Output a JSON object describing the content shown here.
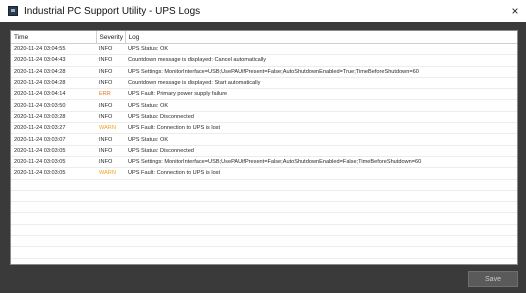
{
  "window": {
    "title": "Industrial PC Support Utility - UPS Logs",
    "close_glyph": "×"
  },
  "table": {
    "columns": [
      "Time",
      "Severity",
      "Log"
    ],
    "rows": [
      {
        "time": "2020-11-24 03:04:55",
        "severity": "INFO",
        "log": "UPS Status: OK"
      },
      {
        "time": "2020-11-24 03:04:43",
        "severity": "INFO",
        "log": "Countdown message is displayed: Cancel automatically"
      },
      {
        "time": "2020-11-24 03:04:28",
        "severity": "INFO",
        "log": "UPS Settings: MonitorInterface=USB;UsePAUifPresent=False;AutoShutdownEnabled=True;TimeBeforeShutdown=60"
      },
      {
        "time": "2020-11-24 03:04:28",
        "severity": "INFO",
        "log": "Countdown message is displayed: Start automatically"
      },
      {
        "time": "2020-11-24 03:04:14",
        "severity": "ERR",
        "log": "UPS Fault: Primary power supply failure"
      },
      {
        "time": "2020-11-24 03:03:50",
        "severity": "INFO",
        "log": "UPS Status: OK"
      },
      {
        "time": "2020-11-24 03:03:28",
        "severity": "INFO",
        "log": "UPS Status: Disconnected"
      },
      {
        "time": "2020-11-24 03:03:27",
        "severity": "WARN",
        "log": "UPS Fault: Connection to UPS is lost"
      },
      {
        "time": "2020-11-24 03:03:07",
        "severity": "INFO",
        "log": "UPS Status: OK"
      },
      {
        "time": "2020-11-24 03:03:05",
        "severity": "INFO",
        "log": "UPS Status: Disconnected"
      },
      {
        "time": "2020-11-24 03:03:05",
        "severity": "INFO",
        "log": "UPS Settings: MonitorInterface=USB;UsePAUifPresent=False;AutoShutdownEnabled=False;TimeBeforeShutdown=60"
      },
      {
        "time": "2020-11-24 03:03:05",
        "severity": "WARN",
        "log": "UPS Fault: Connection to UPS is lost"
      }
    ]
  },
  "footer": {
    "save_label": "Save"
  },
  "colors": {
    "err": "#e8721f",
    "warn": "#f0a020",
    "window_bg": "#3a3a3a"
  }
}
